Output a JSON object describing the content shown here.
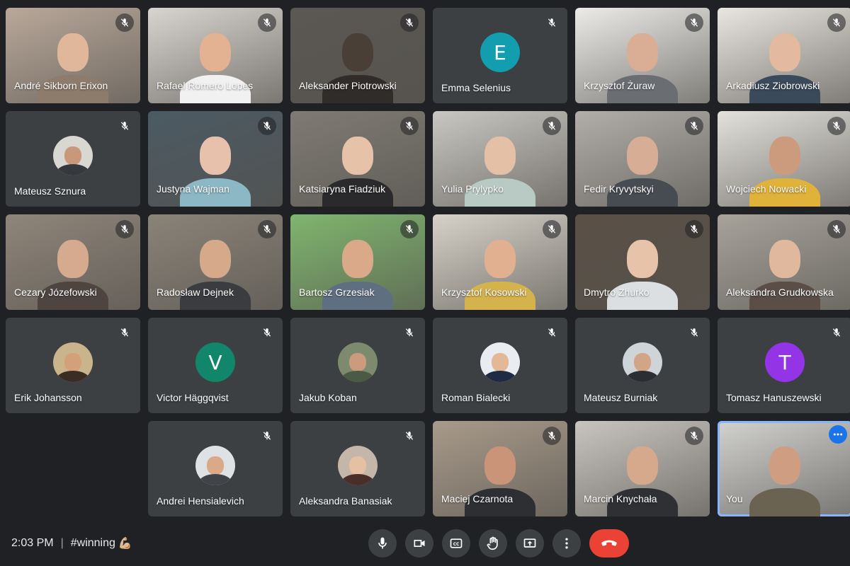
{
  "participants": [
    {
      "name": "André Sikborn Erixon",
      "kind": "video",
      "bg": "#b9a89a",
      "skin": "#e0b79b",
      "shirt": "#8d7b6c"
    },
    {
      "name": "Rafael Romero Lopes",
      "kind": "video",
      "bg": "#d8d5cf",
      "skin": "#e2b292",
      "shirt": "#f1f1f1"
    },
    {
      "name": "Aleksander Piotrowski",
      "kind": "video",
      "bg": "#5b5854",
      "skin": "#4a3f37",
      "shirt": "#2f2c2a"
    },
    {
      "name": "Emma Selenius",
      "kind": "letter",
      "letter": "E",
      "color": "#129eaf"
    },
    {
      "name": "Krzysztof Żuraw",
      "kind": "video",
      "bg": "#ecebe8",
      "skin": "#d9ae94",
      "shirt": "#6a6d72"
    },
    {
      "name": "Arkadiusz Ziobrowski",
      "kind": "video",
      "bg": "#e9e6e0",
      "skin": "#e3b9a0",
      "shirt": "#3a4a5a"
    },
    {
      "name": "Mateusz Sznura",
      "kind": "photo",
      "bg": "#d9d7d2",
      "skin": "#c9977a",
      "shirt": "#35383c"
    },
    {
      "name": "Justyna Wajman",
      "kind": "video",
      "bg": "#4b5a63",
      "skin": "#e8c1ad",
      "shirt": "#8cb7c5"
    },
    {
      "name": "Katsiaryna Fiadziuk",
      "kind": "video",
      "bg": "#7f7b74",
      "skin": "#e6c2a8",
      "shirt": "#2a2a2c"
    },
    {
      "name": "Yulia Prylypko",
      "kind": "video",
      "bg": "#c9c7c2",
      "skin": "#e4c0a6",
      "shirt": "#b9c9c3"
    },
    {
      "name": "Fedir Kryvytskyi",
      "kind": "video",
      "bg": "#b1aeaa",
      "skin": "#d8ad95",
      "shirt": "#474b52"
    },
    {
      "name": "Wojciech Nowacki",
      "kind": "video",
      "bg": "#e3e1dc",
      "skin": "#cc9a7c",
      "shirt": "#e0b23a"
    },
    {
      "name": "Cezary Józefowski",
      "kind": "video",
      "bg": "#8f857a",
      "skin": "#d6aa8e",
      "shirt": "#4e4540"
    },
    {
      "name": "Radosław Dejnek",
      "kind": "video",
      "bg": "#8a8378",
      "skin": "#d7a98b",
      "shirt": "#3b3c3f"
    },
    {
      "name": "Bartosz Grzesiak",
      "kind": "video",
      "bg": "#7fb56e",
      "skin": "#d9a98a",
      "shirt": "#5f6f80"
    },
    {
      "name": "Krzysztof Kosowski",
      "kind": "video",
      "bg": "#d6d2c9",
      "skin": "#e1b091",
      "shirt": "#d4b24c"
    },
    {
      "name": "Dmytro Zhurko",
      "kind": "video",
      "bg": "#5a5046",
      "skin": "#e6c3a9",
      "shirt": "#dcdfe2"
    },
    {
      "name": "Aleksandra Grudkowska",
      "kind": "video",
      "bg": "#a7a39b",
      "skin": "#e0b89e",
      "shirt": "#5a4e47"
    },
    {
      "name": "Erik Johansson",
      "kind": "photo",
      "bg": "#c9b48c",
      "skin": "#d4a07a",
      "shirt": "#3a2e24"
    },
    {
      "name": "Victor Häggqvist",
      "kind": "letter",
      "letter": "V",
      "color": "#12866b"
    },
    {
      "name": "Jakub Koban",
      "kind": "photo",
      "bg": "#7e8a6d",
      "skin": "#cc9b7d",
      "shirt": "#4b5a45"
    },
    {
      "name": "Roman Bialecki",
      "kind": "photo",
      "bg": "#e9edf2",
      "skin": "#e2b896",
      "shirt": "#1f2a44"
    },
    {
      "name": "Mateusz Burniak",
      "kind": "photo",
      "bg": "#cfd4d8",
      "skin": "#d3a587",
      "shirt": "#2b2f33"
    },
    {
      "name": "Tomasz Hanuszewski",
      "kind": "letter",
      "letter": "T",
      "color": "#9334e6"
    },
    {
      "name": "",
      "kind": "empty"
    },
    {
      "name": "Andrei Hensialevich",
      "kind": "photo",
      "bg": "#dfe2e4",
      "skin": "#d9a988",
      "shirt": "#404348"
    },
    {
      "name": "Aleksandra Banasiak",
      "kind": "photo",
      "bg": "#c4b6a8",
      "skin": "#e6c0a2",
      "shirt": "#4a2e28"
    },
    {
      "name": "Maciej Czarnota",
      "kind": "video",
      "bg": "#a89a8a",
      "skin": "#c99478",
      "shirt": "#2d2f33"
    },
    {
      "name": "Marcin Knychała",
      "kind": "video",
      "bg": "#c8c5c0",
      "skin": "#d7a98c",
      "shirt": "#2e3034"
    },
    {
      "name": "You",
      "kind": "self",
      "bg": "#d2d2cf",
      "skin": "#cf9e82",
      "shirt": "#6b6352"
    }
  ],
  "bottom": {
    "time": "2:03 PM",
    "separator": "|",
    "meeting_name": "#winning",
    "meeting_emoji": "💪🏼"
  },
  "icons": {
    "muted": "mic-off-icon",
    "mic": "mic-icon",
    "camera": "camera-icon",
    "captions": "captions-icon",
    "hand": "raise-hand-icon",
    "present": "present-screen-icon",
    "more": "more-vert-icon",
    "end": "end-call-icon"
  },
  "colors": {
    "background": "#202124",
    "tile": "#3c4043",
    "control": "#3c4043",
    "end_call": "#ea4335",
    "active_outline": "#8ab4f8",
    "options_button": "#1a73e8"
  }
}
